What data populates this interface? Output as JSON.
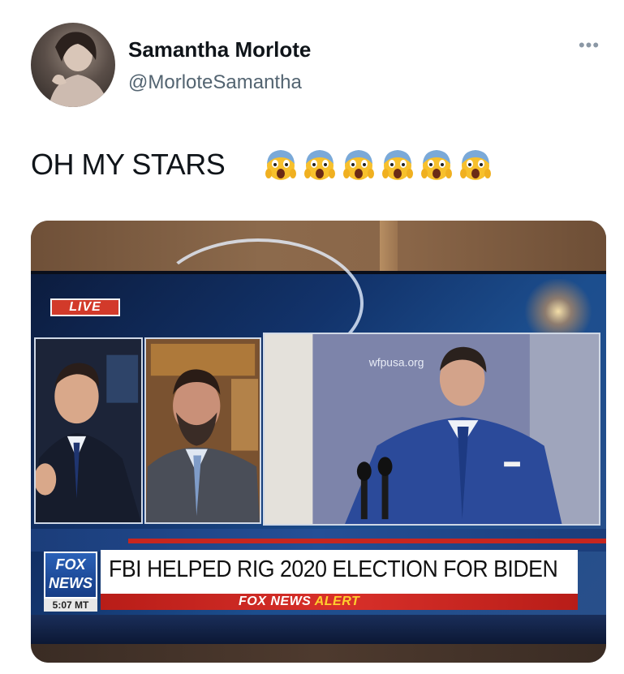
{
  "tweet": {
    "display_name": "Samantha Morlote",
    "handle": "@MorloteSamantha",
    "more_icon": "more-dots-icon",
    "text": "OH MY STARS",
    "emoji_icon": "face-screaming-in-fear-icon",
    "emoji_count": 6
  },
  "media": {
    "live_badge": "LIVE",
    "logo_line1": "FOX",
    "logo_line2": "NEWS",
    "time": "5:07 MT",
    "headline": "FBI HELPED RIG 2020 ELECTION FOR BIDEN",
    "alert_prefix": "FOX NEWS",
    "alert_word": "ALERT",
    "backdrop_text": "wfpusa.org"
  },
  "colors": {
    "alert_red": "#c7261f",
    "fox_blue": "#1b3d7a",
    "handle_gray": "#536471"
  }
}
